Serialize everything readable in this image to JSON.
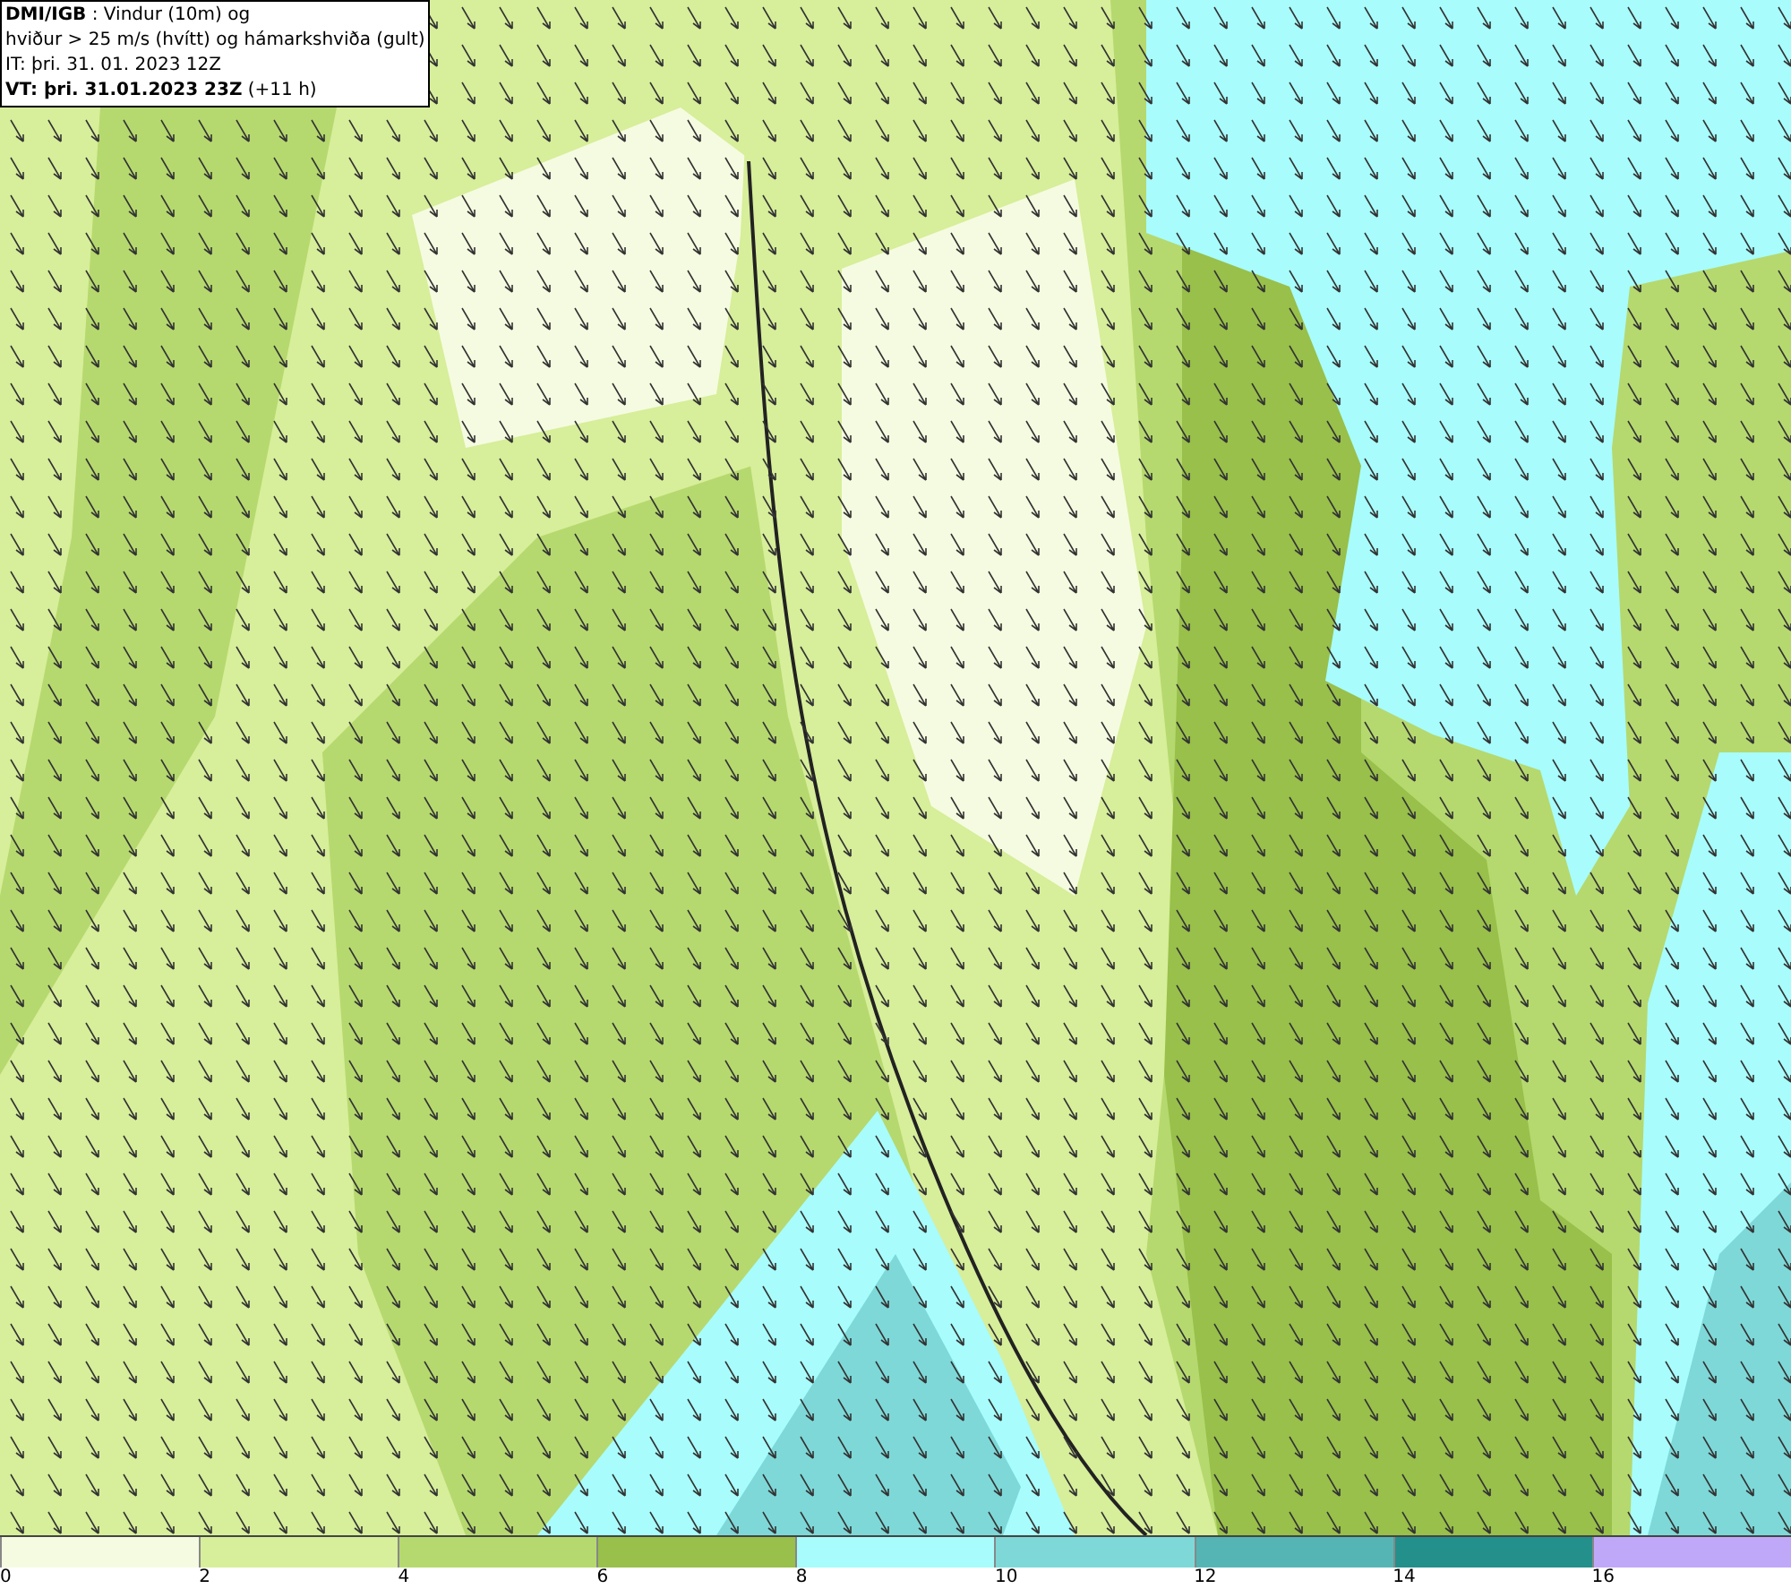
{
  "header": {
    "lines": [
      "**DMI/IGB** : Vindur (10m) og",
      "hviður > 25 m/s (hvítt) og hámarkshviða (gult)",
      "IT: þri. 31. 01. 2023 12Z",
      "**VT: þri. 31.01.2023 23Z** (+11 h)"
    ]
  },
  "legend": {
    "bins": [
      {
        "label": "0",
        "color": "#f5fbe0"
      },
      {
        "label": "2",
        "color": "#d7ee9a"
      },
      {
        "label": "4",
        "color": "#b5d96e"
      },
      {
        "label": "6",
        "color": "#98c04a"
      },
      {
        "label": "8",
        "color": "#a8fcfc"
      },
      {
        "label": "10",
        "color": "#7ed8d8"
      },
      {
        "label": "12",
        "color": "#55b5b5"
      },
      {
        "label": "14",
        "color": "#24908c"
      },
      {
        "label": "16",
        "color": "#c0a8f8"
      }
    ]
  }
}
